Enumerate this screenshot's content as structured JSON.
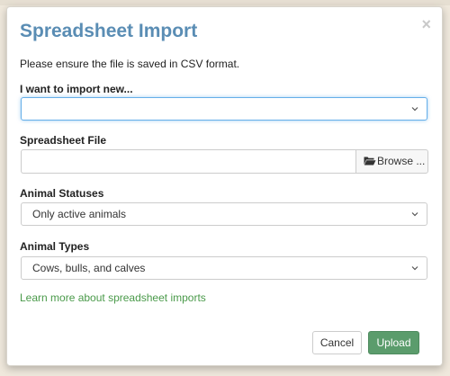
{
  "dialog": {
    "title": "Spreadsheet Import",
    "close_glyph": "×",
    "intro_text": "Please ensure the file is saved in CSV format."
  },
  "import_type": {
    "label": "I want to import new...",
    "value": ""
  },
  "spreadsheet_file": {
    "label": "Spreadsheet File",
    "value": "",
    "browse_label": "Browse ..."
  },
  "animal_statuses": {
    "label": "Animal Statuses",
    "value": "Only active animals"
  },
  "animal_types": {
    "label": "Animal Types",
    "value": "Cows, bulls, and calves"
  },
  "learn_more_link": "Learn more about spreadsheet imports",
  "footer": {
    "cancel_label": "Cancel",
    "upload_label": "Upload"
  },
  "colors": {
    "title": "#5a8db4",
    "link": "#4a9a4a",
    "upload_button": "#5b9c6c",
    "focus_border": "#66afe9"
  },
  "icons": {
    "close": "close-icon",
    "dropdown": "chevron-down-icon",
    "browse": "folder-open-icon"
  }
}
